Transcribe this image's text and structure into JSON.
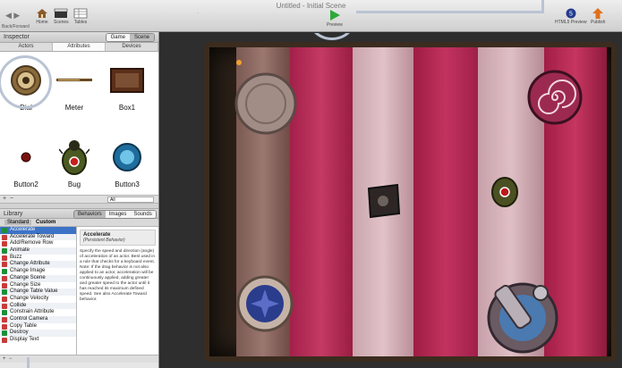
{
  "window": {
    "title": "Untitled - Initial Scene"
  },
  "toolbar": {
    "nav_label": "Back/Forward",
    "home": "Home",
    "scenes": "Scenes",
    "tables": "Tables",
    "preview": "Preview",
    "html5_preview": "HTML5 Preview",
    "publish": "Publish"
  },
  "inspector": {
    "title": "Inspector",
    "mode_game": "Game",
    "mode_scene": "Scene",
    "tabs": [
      "Actors",
      "Attributes",
      "Devices"
    ],
    "filter": "All",
    "actors": [
      {
        "label": "Dial"
      },
      {
        "label": "Meter"
      },
      {
        "label": "Box1"
      },
      {
        "label": "Button2"
      },
      {
        "label": "Bug"
      },
      {
        "label": "Button3"
      }
    ]
  },
  "library": {
    "title": "Library",
    "tabs": [
      "Behaviors",
      "Images",
      "Sounds"
    ],
    "subtabs": [
      "Standard",
      "Custom"
    ],
    "behaviors": [
      "Accelerate",
      "Accelerate Toward",
      "Add/Remove Row",
      "Animate",
      "Buzz",
      "Change Attribute",
      "Change Image",
      "Change Scene",
      "Change Size",
      "Change Table Value",
      "Change Velocity",
      "Collide",
      "Constrain Attribute",
      "Control Camera",
      "Copy Table",
      "Destroy",
      "Display Text"
    ],
    "desc_title": "Accelerate",
    "desc_subtitle": "(Persistent Behavior)",
    "desc_body": "Specify the speed and direction (angle) of acceleration of an actor. Best used in a rule that checks for a keyboard event. Note: If the drag behavior is not also applied to an actor, acceleration will be continuously applied, adding greater and greater speed to the actor until it has reached its maximum defined speed. See also Accelerate Toward behavior."
  },
  "colors": {
    "plank_red": "#b3284e",
    "plank_light": "#c8a0a8",
    "callout": "#b9c4d3",
    "selection": "#3d73c7",
    "preview_green": "#2fa83a"
  }
}
